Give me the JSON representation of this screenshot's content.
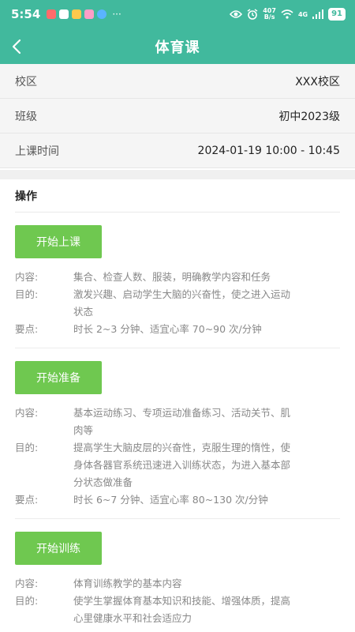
{
  "status": {
    "time": "5:54",
    "more": "···",
    "net_speed_top": "407",
    "net_speed_bottom": "B/s",
    "signal_label": "4G",
    "battery": "91",
    "colors": {
      "bar": "#41b99d"
    }
  },
  "nav": {
    "title": "体育课",
    "back_icon": "chevron-left-icon"
  },
  "info": {
    "campus_label": "校区",
    "campus_value": "XXX校区",
    "class_label": "班级",
    "class_value": "初中2023级",
    "time_label": "上课时间",
    "time_value": "2024-01-19 10:00 - 10:45"
  },
  "ops": {
    "title": "操作",
    "key_content": "内容:",
    "key_purpose": "目的:",
    "key_points": "要点:",
    "items": [
      {
        "button": "开始上课",
        "content": "集合、检查人数、服装，明确教学内容和任务",
        "purpose_1": "激发兴趣、启动学生大脑的兴奋性，使之进入运动",
        "purpose_2": "状态",
        "points": "时长 2~3 分钟、适宜心率 70~90 次/分钟"
      },
      {
        "button": "开始准备",
        "content_1": "基本运动练习、专项运动准备练习、活动关节、肌",
        "content_2": "肉等",
        "purpose_1": "提高学生大脑皮层的兴奋性，克服生理的惰性，使",
        "purpose_2": "身体各器官系统迅速进入训练状态，为进入基本部",
        "purpose_3": "分状态做准备",
        "points": "时长 6~7 分钟、适宜心率 80~130 次/分钟"
      },
      {
        "button": "开始训练",
        "content": "体育训练教学的基本内容",
        "purpose_1": "使学生掌握体育基本知识和技能、增强体质，提高",
        "purpose_2": "心里健康水平和社会适应力"
      }
    ],
    "colors": {
      "button": "#6fc850"
    }
  }
}
